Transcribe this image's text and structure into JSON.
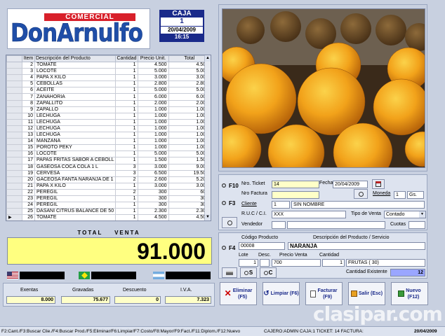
{
  "header": {
    "logo_top": "COMERCIAL",
    "logo_main": "DonArnulfo",
    "caja_label": "CAJA",
    "caja_number": "1",
    "date": "20/04/2009",
    "time": "16:15"
  },
  "table": {
    "columns": [
      "Item",
      "Descripción del Producto",
      "Cantidad",
      "Precio Unit.",
      "Total"
    ],
    "rows": [
      [
        "2",
        "TOMATE",
        "1",
        "4.500",
        "4.500"
      ],
      [
        "3",
        "LOCOTE",
        "1",
        "5.000",
        "5.000"
      ],
      [
        "4",
        "PAPA X KILO",
        "1",
        "3.000",
        "3.000"
      ],
      [
        "5",
        "CEBOLLAS",
        "1",
        "2.800",
        "2.800"
      ],
      [
        "6",
        "ACEITE",
        "1",
        "5.000",
        "5.000"
      ],
      [
        "7",
        "ZANAHORIA",
        "1",
        "6.000",
        "6.000"
      ],
      [
        "8",
        "ZAPALLITO",
        "1",
        "2.000",
        "2.000"
      ],
      [
        "9",
        "ZAPALLO",
        "1",
        "1.000",
        "1.000"
      ],
      [
        "10",
        "LECHUGA",
        "1",
        "1.000",
        "1.000"
      ],
      [
        "11",
        "LECHUGA",
        "1",
        "1.000",
        "1.000"
      ],
      [
        "12",
        "LECHUGA",
        "1",
        "1.000",
        "1.000"
      ],
      [
        "13",
        "LECHUGA",
        "1",
        "1.000",
        "1.000"
      ],
      [
        "14",
        "MANZANA",
        "1",
        "1.000",
        "1.000"
      ],
      [
        "15",
        "POROTO PEKY",
        "1",
        "1.000",
        "1.000"
      ],
      [
        "16",
        "LOCOTE",
        "1",
        "5.000",
        "5.000"
      ],
      [
        "17",
        "PAPAS FRITAS SABOR A CEBOLL",
        "1",
        "1.500",
        "1.500"
      ],
      [
        "18",
        "GASEOSA COCA COLA 1 L",
        "3",
        "3.000",
        "9.000"
      ],
      [
        "19",
        "CERVESA",
        "3",
        "6.500",
        "19.500"
      ],
      [
        "20",
        "GACEOSA FANTA NARANJA DE 1",
        "2",
        "2.600",
        "5.200"
      ],
      [
        "21",
        "PAPA X KILO",
        "1",
        "3.000",
        "3.000"
      ],
      [
        "22",
        "PEREGIL",
        "2",
        "300",
        "600"
      ],
      [
        "23",
        "PEREGIL",
        "1",
        "300",
        "300"
      ],
      [
        "24",
        "PEREGIL",
        "1",
        "300",
        "300"
      ],
      [
        "25",
        "DASANI CITRUS BALANCE DE 50",
        "1",
        "2.300",
        "2.300"
      ],
      [
        "26",
        "TOMATE",
        "1",
        "4.500",
        "4.500"
      ]
    ]
  },
  "total": {
    "label": "TOTAL    VENTA",
    "value": "91.000"
  },
  "summary": {
    "exentas_label": "Exentas",
    "exentas_value": "8.000",
    "gravadas_label": "Gravadas",
    "gravadas_value": "75.677",
    "descuento_label": "Descuento",
    "descuento_value": "0",
    "iva_label": "I.V.A.",
    "iva_value": "7.323"
  },
  "form": {
    "f10": "F10",
    "f3": "F3",
    "f4": "F4",
    "s_key": "S",
    "c_key": "C",
    "ticket_label": "Nro. Ticket",
    "ticket_value": "14",
    "fecha_label": "Fecha",
    "fecha_value": "20/04/2009",
    "factura_label": "Nro Factura",
    "moneda_label": "Moneda",
    "moneda_value": "1",
    "moneda_code": "Gs.",
    "cliente_label": "Cliente",
    "cliente_code": "1",
    "cliente_name": "SIN NOMBRE",
    "ruc_label": "R.U.C / C.I.",
    "ruc_value": "XXX",
    "tipo_venta_label": "Tipo de Venta",
    "tipo_venta_value": "Contado",
    "vendedor_label": "Vendedor",
    "cuotas_label": "Cuotas",
    "codigo_label": "Código Producto",
    "codigo_value": "00008",
    "desc_label": "Descripción del Producto / Servicio",
    "desc_value": "NARANJA",
    "lote_label": "Lote",
    "desc_short_label": "Desc.",
    "precio_label": "Precio Venta",
    "cantidad_label": "Cantidad",
    "lote_value": "1",
    "precio_value": "700",
    "cantidad_value": "1",
    "categoria_value": "FRUTAS  ( 30)",
    "existente_label": "Cantidad Existente",
    "existente_value": "12"
  },
  "buttons": {
    "eliminar": "Eliminar\n(F5)",
    "limpiar": "Limpiar (F6)",
    "facturar": "Facturar\n(F9)",
    "salir": "Salir (Esc)",
    "nuevo": "Nuevo\n(F12)"
  },
  "status": {
    "shortcuts": "F2:Cant./F3:Buscar Clie./F4:Buscar Prod./F5:Eliminar/F6:Limpiar/F7:Costo/F8:Mayor/F9:Fact./F11:Diplom./F12:Nuevo",
    "user_info": "CAJERO:ADMIN  CAJA:1  TICKET: 14  FACTURA:",
    "date": "20/04/2009"
  },
  "watermark": "clasipar.com",
  "colors": {
    "accent_blue": "#1a2a8a",
    "total_yellow": "#ffff80",
    "logo_red": "#d8202a",
    "logo_blue": "#1f4ea8"
  },
  "icons": [
    "calendar-icon",
    "search-icon",
    "printer-icon",
    "delete-x-icon",
    "clear-icon",
    "invoice-icon",
    "exit-icon",
    "new-icon",
    "flag-usa-icon",
    "flag-brazil-icon",
    "flag-argentina-icon"
  ]
}
